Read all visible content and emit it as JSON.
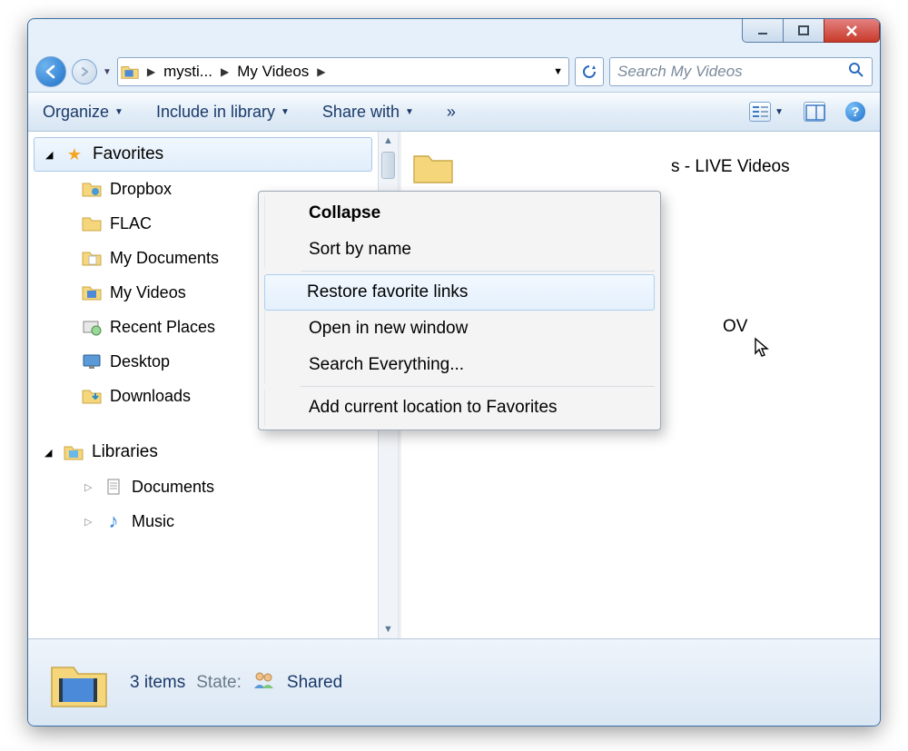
{
  "nav": {
    "crumb1": "mysti...",
    "crumb2": "My Videos",
    "search_placeholder": "Search My Videos"
  },
  "toolbar": {
    "organize": "Organize",
    "include": "Include in library",
    "share": "Share with",
    "more": "»"
  },
  "sidebar": {
    "favorites": "Favorites",
    "items": [
      {
        "label": "Dropbox"
      },
      {
        "label": "FLAC"
      },
      {
        "label": "My Documents"
      },
      {
        "label": "My Videos"
      },
      {
        "label": "Recent Places"
      },
      {
        "label": "Desktop"
      },
      {
        "label": "Downloads"
      }
    ],
    "libraries": "Libraries",
    "libs": [
      {
        "label": "Documents"
      },
      {
        "label": "Music"
      }
    ]
  },
  "content": {
    "file1_suffix": "s - LIVE Videos",
    "file2_suffix": "OV"
  },
  "status": {
    "count": "3 items",
    "state_label": "State:",
    "state_value": "Shared"
  },
  "context": {
    "collapse": "Collapse",
    "sort": "Sort by name",
    "restore": "Restore favorite links",
    "open": "Open in new window",
    "search": "Search Everything...",
    "add": "Add current location to Favorites"
  }
}
